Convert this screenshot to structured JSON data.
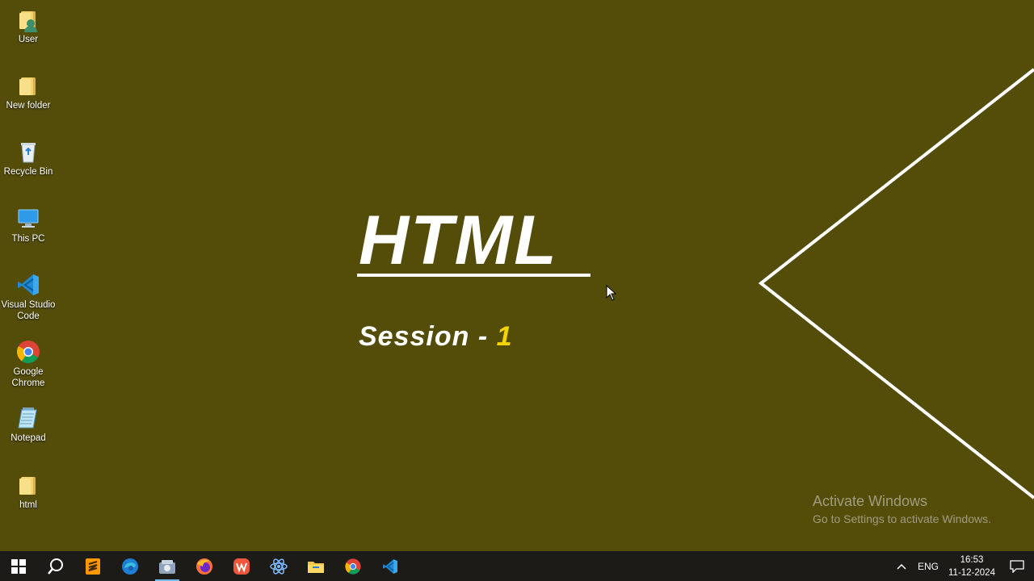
{
  "desktop": {
    "icons": [
      {
        "label": "User",
        "icon": "user-folder-icon"
      },
      {
        "label": "New folder",
        "icon": "folder-icon"
      },
      {
        "label": "Recycle Bin",
        "icon": "recycle-bin-icon"
      },
      {
        "label": "This PC",
        "icon": "computer-icon"
      },
      {
        "label": "Visual Studio Code",
        "icon": "vscode-icon"
      },
      {
        "label": "Google Chrome",
        "icon": "chrome-icon"
      },
      {
        "label": "Notepad",
        "icon": "notepad-icon"
      },
      {
        "label": "html",
        "icon": "folder-icon"
      }
    ]
  },
  "slide": {
    "title": "HTML",
    "session_label": "Session - ",
    "session_number": "1"
  },
  "watermark": {
    "line1": "Activate Windows",
    "line2": "Go to Settings to activate Windows."
  },
  "taskbar": {
    "apps": [
      "start-icon",
      "search-icon",
      "sublime-text-icon",
      "edge-icon",
      "app-icon",
      "firefox-icon",
      "wps-office-icon",
      "react-devtools-icon",
      "file-explorer-icon",
      "chrome-icon",
      "vscode-icon"
    ],
    "language": "ENG",
    "time": "16:53",
    "date": "11-12-2024"
  },
  "colors": {
    "background": "#544d0a",
    "accent_number": "#f5d400",
    "taskbar": "#1c1b17"
  }
}
